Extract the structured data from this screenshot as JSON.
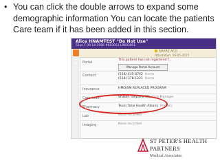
{
  "slide": {
    "bullet": "•",
    "text": "You can click the double arrows to expand some demographic information You can locate the patients Care team if it has been added in this section."
  },
  "patient": {
    "name": "Alice HNAMTEST \"Do Not Use\"",
    "sub": "63yo F  09-14-1956  #603051  LR603051",
    "right_panel_label": "SHARE ACO",
    "right_panel_date": "Attestation: 06-05-2015"
  },
  "portal": {
    "label": "Portal",
    "notice": "This patient has not registered f...",
    "button_label": "Manage Portal Account"
  },
  "rows": [
    {
      "label": "Contact",
      "line1": "(518) 435-0762",
      "line1_suffix": "Home",
      "line2": "(518) 378-1221",
      "line2_suffix": "Home"
    },
    {
      "label": "Insurance",
      "line1": "HMO/SM REPLACED PROGRAM",
      "line1_suffix": ""
    },
    {
      "label": "Care team",
      "line1": "Sharon Timpano RN",
      "line1_suffix": "Care Manager"
    },
    {
      "label": "Pharmacy",
      "line1": "Team Total Health Albany",
      "line1_suffix": "Primary"
    },
    {
      "label": "Lab",
      "line1": "None recorded",
      "line1_suffix": ""
    },
    {
      "label": "Imaging",
      "line1": "None recorded",
      "line1_suffix": ""
    }
  ],
  "logo": {
    "line1": "ST PETER'S HEALTH",
    "line2": "PARTNERS",
    "line3": "Medical Associates"
  },
  "colors": {
    "header_purple": "#4a2f86",
    "highlight_red": "#d9231c",
    "arrow_orange": "#f07f22"
  },
  "icons": [
    "double-arrow-icon",
    "logo-mark-icon"
  ]
}
